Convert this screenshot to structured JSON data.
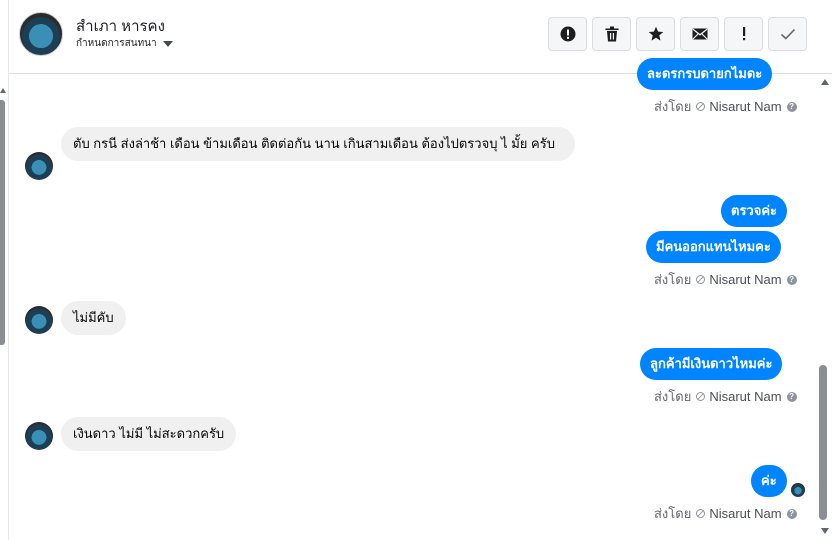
{
  "header": {
    "contact_name": "สำเภา หารคง",
    "status_label": "กำหนดการสนทนา"
  },
  "toolbar": {
    "buttons": [
      {
        "icon": "alert-circle-icon"
      },
      {
        "icon": "trash-icon"
      },
      {
        "icon": "star-icon"
      },
      {
        "icon": "envelope-icon"
      },
      {
        "icon": "exclamation-icon"
      },
      {
        "icon": "checkmark-icon"
      }
    ]
  },
  "messages": [
    {
      "direction": "out",
      "text": "ละดรกรบดายกไมดะ"
    },
    {
      "direction": "in",
      "text": "ตับ กรนี ส่งล่าช้า  เดือน ข้ามเดือน   ติดต่อกัน นาน เกินสามเดือน   ต้องไปตรวจบุ ไ มั้ย ครับ"
    },
    {
      "direction": "out",
      "text": "ตรวจค่ะ"
    },
    {
      "direction": "out",
      "text": "มีคนออกแทนไหมคะ"
    },
    {
      "direction": "in",
      "text": "ไม่มีคับ"
    },
    {
      "direction": "out",
      "text": "ลูกค้ามีเงินดาวไหมค่ะ"
    },
    {
      "direction": "in",
      "text": "เงินดาว ไม่มี ไม่สะดวกครับ"
    },
    {
      "direction": "out",
      "text": "ค่ะ"
    }
  ],
  "sent_by": {
    "prefix": "ส่งโดย",
    "sender": "Nisarut Nam",
    "help": "?"
  },
  "colors": {
    "accent": "#0084ff",
    "incoming_bubble": "#f0f0f0"
  }
}
